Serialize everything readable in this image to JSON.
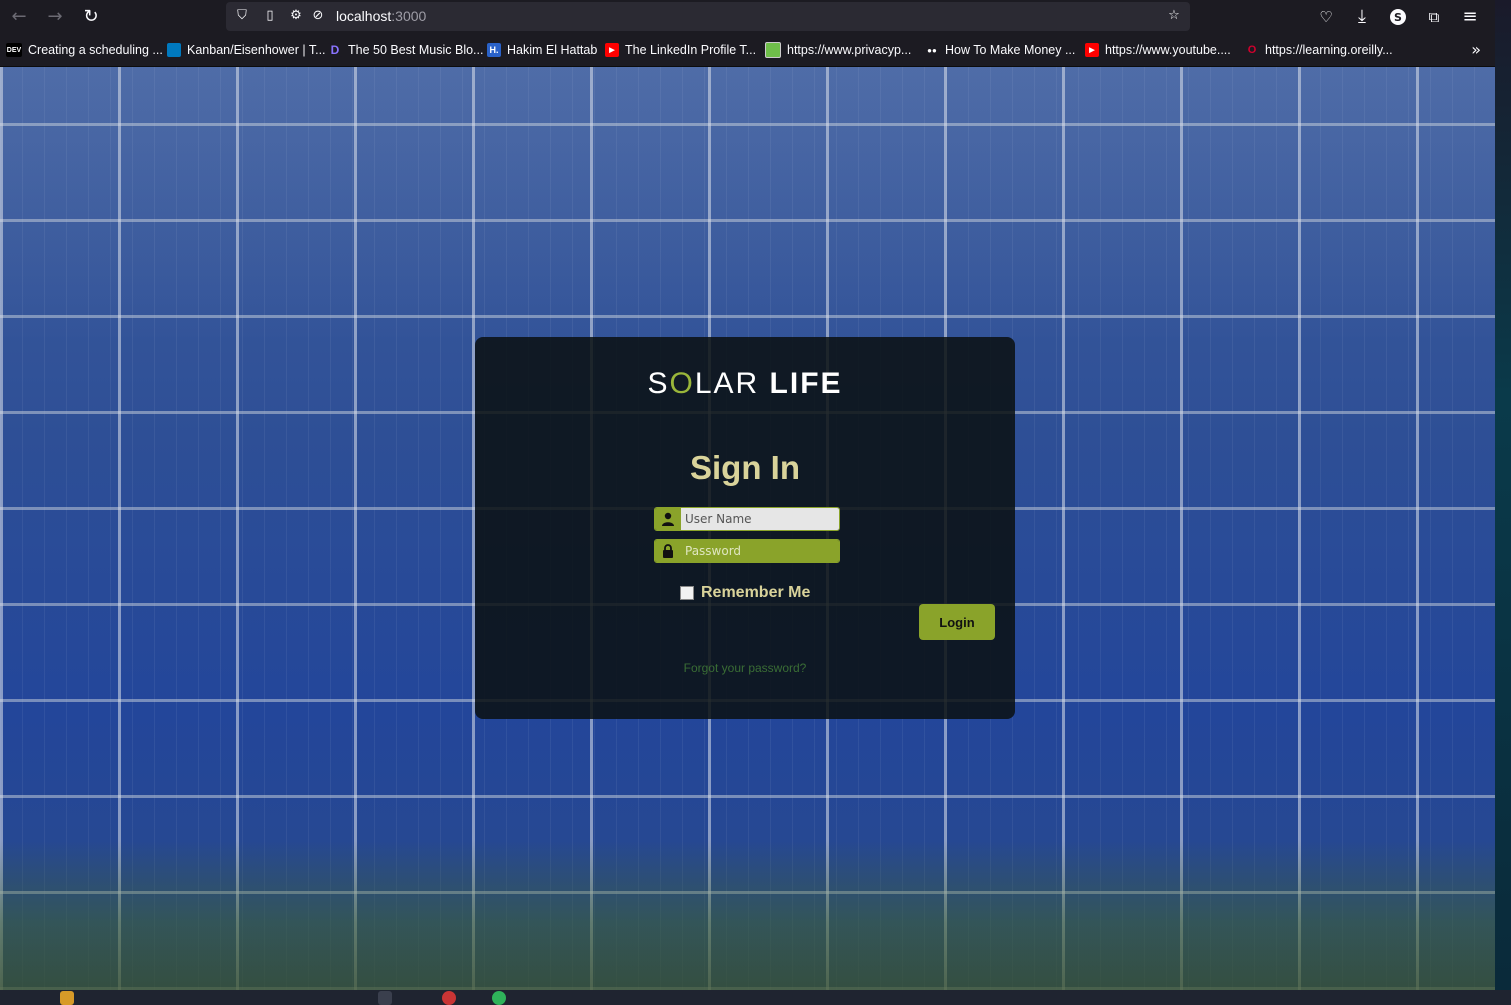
{
  "browser": {
    "url_host": "localhost",
    "url_port": ":3000",
    "bookmarks": [
      {
        "label": "Creating a scheduling ...",
        "icon": "dev-icon",
        "color": "#000000",
        "glyph": "DEV"
      },
      {
        "label": "Kanban/Eisenhower | T...",
        "icon": "trello-icon",
        "color": "#0079bf",
        "glyph": ""
      },
      {
        "label": "The 50 Best Music Blo...",
        "icon": "d-icon",
        "color": "#6b4cff",
        "glyph": "D"
      },
      {
        "label": "Hakim El Hattab",
        "icon": "h-icon",
        "color": "#2a62c9",
        "glyph": "H."
      },
      {
        "label": "The LinkedIn Profile T...",
        "icon": "youtube-icon",
        "color": "#ff0000",
        "glyph": "▶"
      },
      {
        "label": "https://www.privacyp...",
        "icon": "privacy-icon",
        "color": "#6fbf4a",
        "glyph": ""
      },
      {
        "label": "How To Make Money ...",
        "icon": "medium-icon",
        "color": "#000000",
        "glyph": "●●"
      },
      {
        "label": "https://www.youtube....",
        "icon": "youtube-icon",
        "color": "#ff0000",
        "glyph": "▶"
      },
      {
        "label": "https://learning.oreilly...",
        "icon": "oreilly-icon",
        "color": "#d3002d",
        "glyph": "O"
      }
    ]
  },
  "login": {
    "logo_s": "S",
    "logo_o": "O",
    "logo_lar": "LAR",
    "logo_life": "LIFE",
    "title": "Sign In",
    "username_placeholder": "User Name",
    "password_placeholder": "Password",
    "remember_label": "Remember Me",
    "login_button": "Login",
    "forgot_link": "Forgot your password?",
    "accent_color": "#8aa32a"
  }
}
